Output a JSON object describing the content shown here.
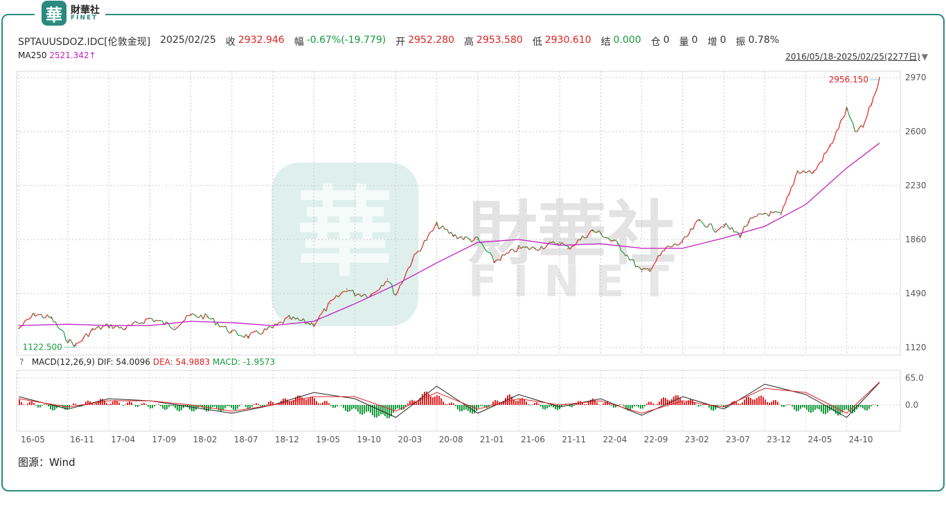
{
  "brand": {
    "badge_char": "華",
    "name_cn": "財華社",
    "name_en": "FINET"
  },
  "quote": {
    "symbol": "SPTAUUSDOZ.IDC[伦敦金现]",
    "date": "2025/02/25",
    "close_label": "收",
    "close": "2932.946",
    "change_label": "幅",
    "change": "-0.67%(-19.779)",
    "open_label": "开",
    "open": "2952.280",
    "high_label": "高",
    "high": "2953.580",
    "low_label": "低",
    "low": "2930.610",
    "settle_label": "结",
    "settle": "0.000",
    "position_label": "仓",
    "position": "0",
    "volume_label": "量",
    "volume": "0",
    "increase_label": "增",
    "increase": "0",
    "amplitude_label": "振",
    "amplitude": "0.78%"
  },
  "ma": {
    "label": "MA250",
    "value": "2521.342↑"
  },
  "range_text": "2016/05/18-2025/02/25(2277日)",
  "macd_info": {
    "help": "?",
    "label": "MACD(12,26,9)",
    "dif": "DIF: 54.0096",
    "dea": "DEA: 54.9883",
    "macd": "MACD: -1.9573"
  },
  "source": "图源：Wind",
  "colors": {
    "up": "#e02020",
    "down": "#159a3c",
    "ma": "#c020c0",
    "accent": "#2a8a7e"
  },
  "chart_data": {
    "type": "line",
    "x_tick_labels": [
      "16-05",
      "16-11",
      "17-04",
      "17-09",
      "18-02",
      "18-07",
      "18-12",
      "19-05",
      "19-10",
      "20-03",
      "20-08",
      "21-01",
      "21-06",
      "21-11",
      "22-04",
      "22-09",
      "23-02",
      "23-07",
      "23-12",
      "24-05",
      "24-10"
    ],
    "y_ticks": [
      1120,
      1490,
      1860,
      2230,
      2600,
      2970
    ],
    "ylim": [
      1120,
      2970
    ],
    "max_label": "2956.150",
    "min_label": "1122.500",
    "series": [
      {
        "name": "SPTAUUSDOZ.IDC",
        "x": [
          "16-05",
          "16-07",
          "16-09",
          "16-11",
          "16-12",
          "17-02",
          "17-04",
          "17-06",
          "17-09",
          "17-12",
          "18-02",
          "18-04",
          "18-07",
          "18-09",
          "18-12",
          "19-02",
          "19-05",
          "19-07",
          "19-09",
          "19-10",
          "19-12",
          "20-02",
          "20-03",
          "20-05",
          "20-08",
          "20-10",
          "20-12",
          "21-01",
          "21-03",
          "21-06",
          "21-08",
          "21-11",
          "21-12",
          "22-03",
          "22-04",
          "22-06",
          "22-09",
          "22-10",
          "22-12",
          "23-02",
          "23-04",
          "23-06",
          "23-07",
          "23-09",
          "23-10",
          "23-12",
          "24-02",
          "24-03",
          "24-04",
          "24-06",
          "24-08",
          "24-10",
          "24-11",
          "24-12",
          "25-01",
          "25-02"
        ],
        "values": [
          1250,
          1350,
          1320,
          1170,
          1135,
          1240,
          1270,
          1250,
          1320,
          1260,
          1340,
          1330,
          1225,
          1195,
          1255,
          1320,
          1280,
          1420,
          1520,
          1490,
          1480,
          1590,
          1480,
          1720,
          1960,
          1890,
          1860,
          1860,
          1710,
          1800,
          1800,
          1840,
          1800,
          1920,
          1900,
          1830,
          1640,
          1660,
          1800,
          1840,
          1990,
          1930,
          1960,
          1890,
          1980,
          2040,
          2030,
          2170,
          2330,
          2320,
          2500,
          2750,
          2600,
          2630,
          2790,
          2956
        ]
      },
      {
        "name": "MA250",
        "x": [
          "16-05",
          "16-11",
          "17-04",
          "17-09",
          "18-02",
          "18-07",
          "18-12",
          "19-05",
          "19-10",
          "20-03",
          "20-08",
          "21-01",
          "21-06",
          "21-11",
          "22-04",
          "22-09",
          "23-02",
          "23-07",
          "23-12",
          "24-05",
          "24-10",
          "25-02"
        ],
        "values": [
          1270,
          1280,
          1270,
          1270,
          1300,
          1290,
          1270,
          1300,
          1420,
          1550,
          1700,
          1840,
          1860,
          1820,
          1830,
          1800,
          1800,
          1870,
          1950,
          2100,
          2350,
          2521
        ]
      }
    ],
    "macd": {
      "y_ticks": [
        0.0,
        65.0
      ],
      "x": [
        "16-05",
        "16-11",
        "17-04",
        "17-09",
        "18-02",
        "18-07",
        "18-12",
        "19-05",
        "19-10",
        "20-03",
        "20-08",
        "21-01",
        "21-06",
        "21-11",
        "22-04",
        "22-09",
        "23-02",
        "23-07",
        "23-12",
        "24-05",
        "24-10",
        "25-02"
      ],
      "dif": [
        20,
        -10,
        15,
        10,
        -5,
        -20,
        0,
        30,
        15,
        -30,
        45,
        -20,
        25,
        -5,
        15,
        -25,
        20,
        -10,
        50,
        25,
        -30,
        54
      ],
      "dea": [
        15,
        -5,
        10,
        10,
        0,
        -15,
        0,
        20,
        20,
        -15,
        30,
        -10,
        15,
        0,
        10,
        -20,
        10,
        -5,
        40,
        30,
        -20,
        55
      ]
    }
  }
}
